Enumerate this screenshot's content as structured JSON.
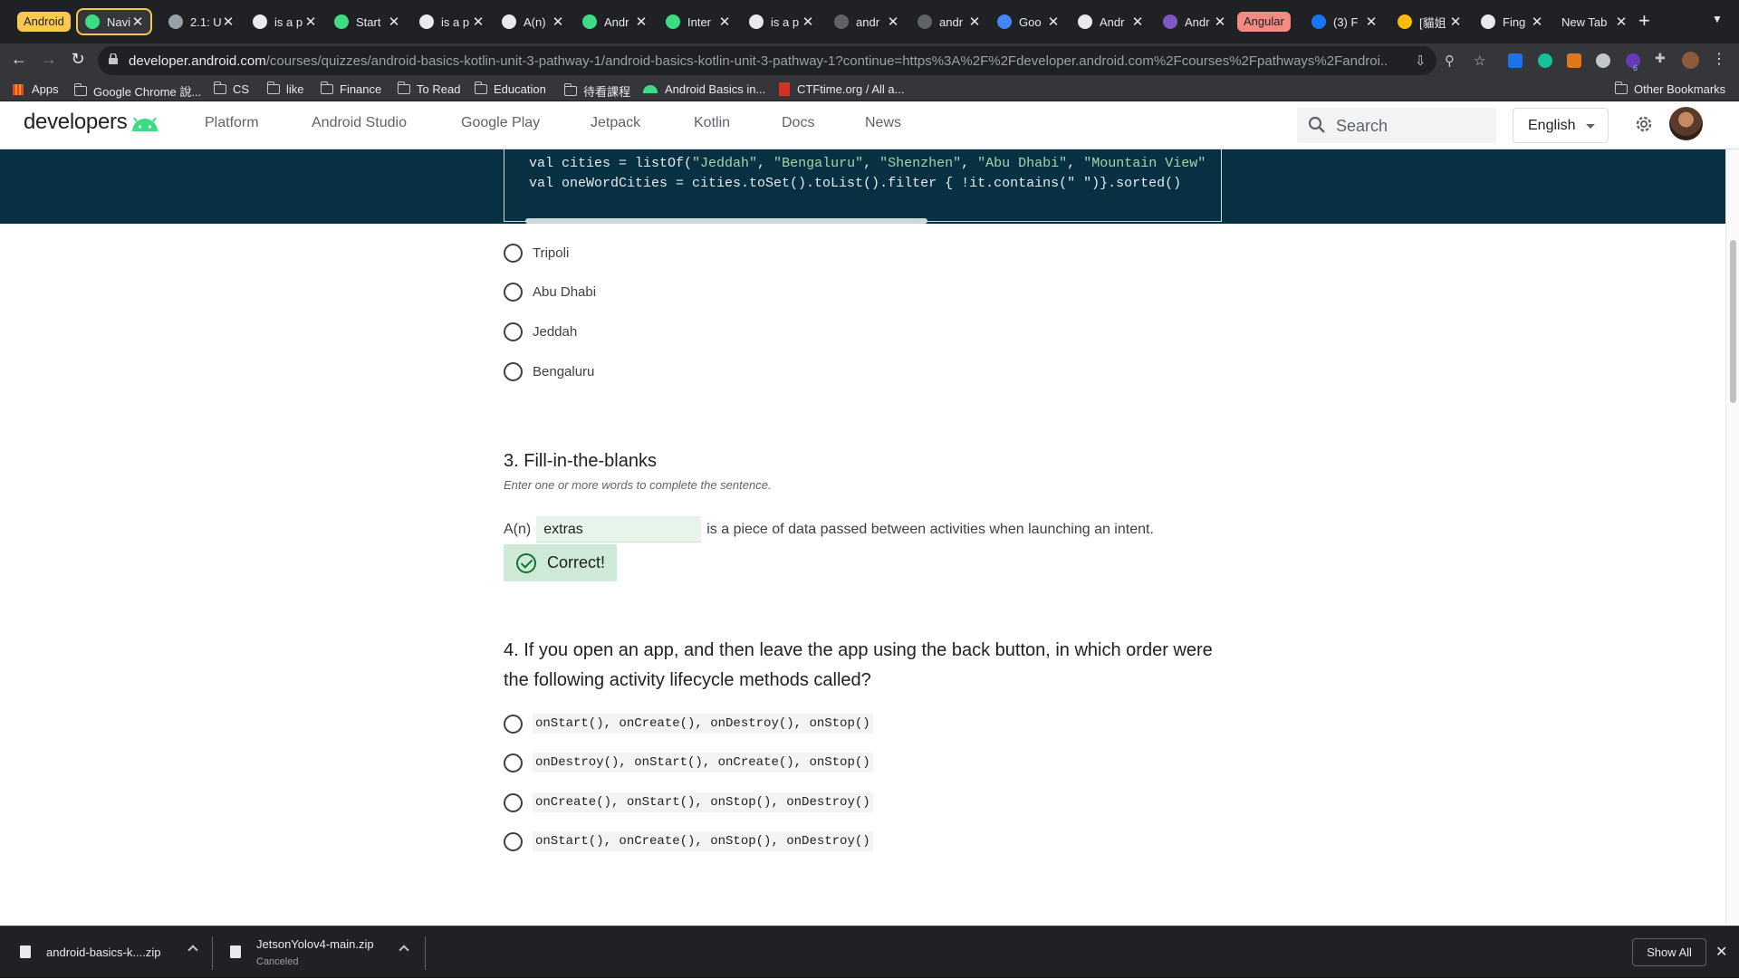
{
  "browser": {
    "tab_groups": [
      {
        "label": "Android",
        "color": "#f8c94c"
      },
      {
        "label": "Angular",
        "color": "#f28b82"
      }
    ],
    "tabs": [
      {
        "title": "Navi",
        "icon": "android-icon",
        "color": "#3ddc84",
        "active": true
      },
      {
        "title": "2.1: U",
        "icon": "book-icon",
        "color": "#9aa0a6"
      },
      {
        "title": "is a p",
        "icon": "google-icon",
        "color": "#e8eaed"
      },
      {
        "title": "Start",
        "icon": "android-icon",
        "color": "#3ddc84"
      },
      {
        "title": "is a p",
        "icon": "google-icon",
        "color": "#e8eaed"
      },
      {
        "title": "A(n)",
        "icon": "google-icon",
        "color": "#e8eaed"
      },
      {
        "title": "Andr",
        "icon": "android-icon",
        "color": "#3ddc84"
      },
      {
        "title": "Inter",
        "icon": "android-icon",
        "color": "#3ddc84"
      },
      {
        "title": "is a p",
        "icon": "google-icon",
        "color": "#e8eaed"
      },
      {
        "title": "andr",
        "icon": "github-icon",
        "color": "#5f6368"
      },
      {
        "title": "andr",
        "icon": "github-icon",
        "color": "#5f6368"
      },
      {
        "title": "Goo",
        "icon": "google-translate-icon",
        "color": "#4285f4"
      },
      {
        "title": "Andr",
        "icon": "google-icon",
        "color": "#e8eaed"
      },
      {
        "title": "Andr",
        "icon": "list-icon",
        "color": "#7e57c2"
      },
      {
        "title": "(3) F",
        "icon": "facebook-icon",
        "color": "#1877f2"
      },
      {
        "title": "[貓姐",
        "icon": "colorful-icon",
        "color": "#fbbc04"
      },
      {
        "title": "Fing",
        "icon": "page-icon",
        "color": "#e8eaed"
      },
      {
        "title": "New Tab",
        "icon": "",
        "color": ""
      }
    ],
    "url_host": "developer.android.com",
    "url_path": "/courses/quizzes/android-basics-kotlin-unit-3-pathway-1/android-basics-kotlin-unit-3-pathway-1?continue=https%3A%2F%2Fdeveloper.android.com%2Fcourses%2Fpathways%2Fandroi...",
    "extension_badge": "6",
    "bookmarks": [
      {
        "label": "Apps",
        "icon": "apps-grid-icon"
      },
      {
        "label": "Google Chrome 說...",
        "icon": "folder-icon"
      },
      {
        "label": "CS",
        "icon": "folder-icon"
      },
      {
        "label": "like",
        "icon": "folder-icon"
      },
      {
        "label": "Finance",
        "icon": "folder-icon"
      },
      {
        "label": "To Read",
        "icon": "folder-icon"
      },
      {
        "label": "Education",
        "icon": "folder-icon"
      },
      {
        "label": "待看課程",
        "icon": "folder-icon"
      },
      {
        "label": "Android Basics in...",
        "icon": "android-icon"
      },
      {
        "label": "CTFtime.org / All a...",
        "icon": "ctf-flag-icon"
      }
    ],
    "other_bookmarks": "Other Bookmarks"
  },
  "site": {
    "logo_text": "developers",
    "nav": [
      "Platform",
      "Android Studio",
      "Google Play",
      "Jetpack",
      "Kotlin",
      "Docs",
      "News"
    ],
    "search_placeholder": "Search",
    "language": "English"
  },
  "code": {
    "line1_prefix": "val cities = listOf(",
    "line1_items": [
      "\"Jeddah\"",
      "\"Bengaluru\"",
      "\"Shenzhen\"",
      "\"Abu Dhabi\"",
      "\"Mountain View\""
    ],
    "line2": "val oneWordCities = cities.toSet().toList().filter { !it.contains(\" \")}.sorted()"
  },
  "quiz": {
    "q2_options": [
      "Tripoli",
      "Abu Dhabi",
      "Jeddah",
      "Bengaluru"
    ],
    "q3_title": "3. Fill-in-the-blanks",
    "q3_hint": "Enter one or more words to complete the sentence.",
    "q3_prefix": "A(n)",
    "q3_answer": "extras",
    "q3_suffix": "is a piece of data passed between activities when launching an intent.",
    "q3_feedback": "Correct!",
    "q4_title": "4. If you open an app, and then leave the app using the back button, in which order were the following activity lifecycle methods called?",
    "q4_options": [
      "onStart(), onCreate(), onDestroy(), onStop()",
      "onDestroy(), onStart(), onCreate(), onStop()",
      "onCreate(), onStart(), onStop(), onDestroy()",
      "onStart(), onCreate(), onStop(), onDestroy()"
    ]
  },
  "downloads": {
    "items": [
      {
        "name": "android-basics-k....zip",
        "status": ""
      },
      {
        "name": "JetsonYolov4-main.zip",
        "status": "Canceled"
      }
    ],
    "show_all": "Show All"
  }
}
